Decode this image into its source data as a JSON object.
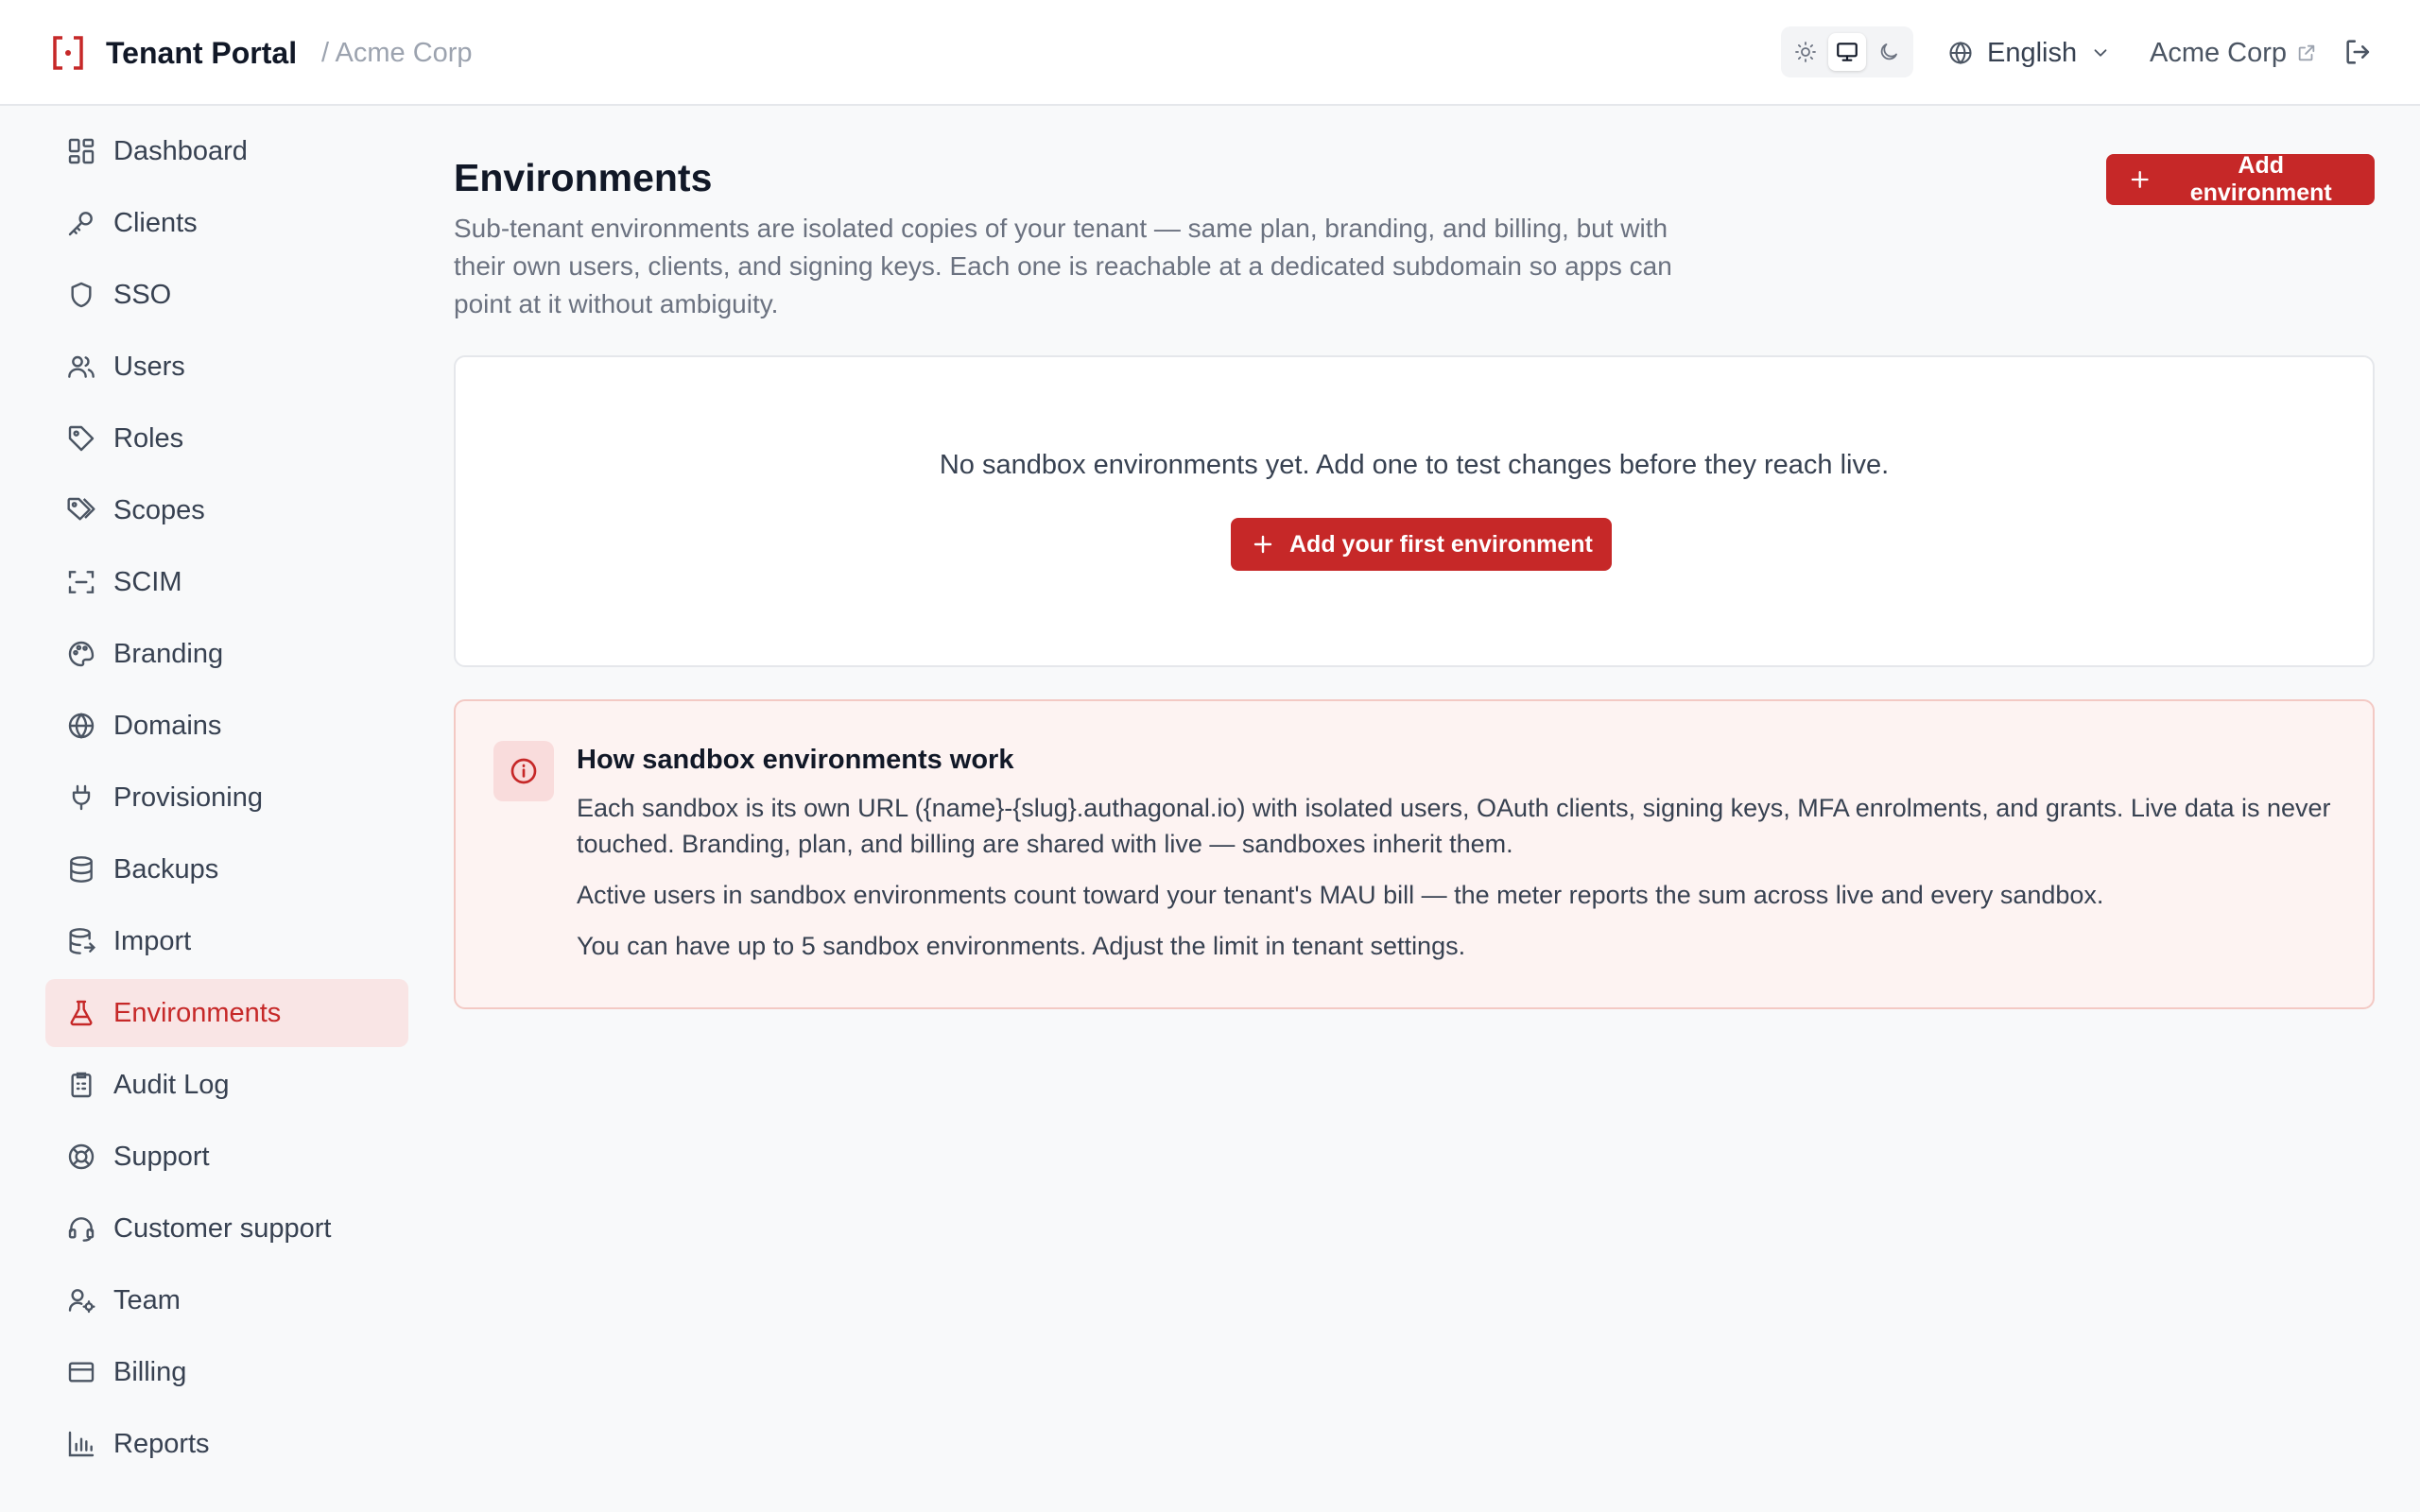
{
  "header": {
    "brand_name": "Tenant Portal",
    "breadcrumb": "/ Acme Corp",
    "language": "English",
    "tenant_link": "Acme Corp",
    "theme_modes": [
      "light",
      "system",
      "dark"
    ],
    "theme_active": "system"
  },
  "sidebar": {
    "items": [
      {
        "label": "Dashboard",
        "icon": "dashboard-icon"
      },
      {
        "label": "Clients",
        "icon": "key-icon"
      },
      {
        "label": "SSO",
        "icon": "shield-icon"
      },
      {
        "label": "Users",
        "icon": "users-icon"
      },
      {
        "label": "Roles",
        "icon": "tag-icon"
      },
      {
        "label": "Scopes",
        "icon": "tags-icon"
      },
      {
        "label": "SCIM",
        "icon": "scan-icon"
      },
      {
        "label": "Branding",
        "icon": "palette-icon"
      },
      {
        "label": "Domains",
        "icon": "globe-icon"
      },
      {
        "label": "Provisioning",
        "icon": "plug-icon"
      },
      {
        "label": "Backups",
        "icon": "database-icon"
      },
      {
        "label": "Import",
        "icon": "database-import-icon"
      },
      {
        "label": "Environments",
        "icon": "flask-icon",
        "active": true
      },
      {
        "label": "Audit Log",
        "icon": "clipboard-icon"
      },
      {
        "label": "Support",
        "icon": "lifebuoy-icon"
      },
      {
        "label": "Customer support",
        "icon": "headset-icon"
      },
      {
        "label": "Team",
        "icon": "user-cog-icon"
      },
      {
        "label": "Billing",
        "icon": "credit-card-icon"
      },
      {
        "label": "Reports",
        "icon": "bar-chart-icon"
      }
    ]
  },
  "main": {
    "title": "Environments",
    "description": "Sub-tenant environments are isolated copies of your tenant — same plan, branding, and billing, but with their own users, clients, and signing keys. Each one is reachable at a dedicated subdomain so apps can point at it without ambiguity.",
    "add_button": "Add environment",
    "empty_text": "No sandbox environments yet. Add one to test changes before they reach live.",
    "empty_button": "Add your first environment",
    "info": {
      "title": "How sandbox environments work",
      "paragraphs": [
        "Each sandbox is its own URL ({name}-{slug}.authagonal.io) with isolated users, OAuth clients, signing keys, MFA enrolments, and grants. Live data is never touched. Branding, plan, and billing are shared with live — sandboxes inherit them.",
        "Active users in sandbox environments count toward your tenant's MAU bill — the meter reports the sum across live and every sandbox.",
        "You can have up to 5 sandbox environments. Adjust the limit in tenant settings."
      ]
    }
  },
  "colors": {
    "accent": "#c62828",
    "active_nav_bg": "#f9e5e5",
    "info_bg": "#fdf3f2",
    "info_border": "#f3c9c4"
  }
}
